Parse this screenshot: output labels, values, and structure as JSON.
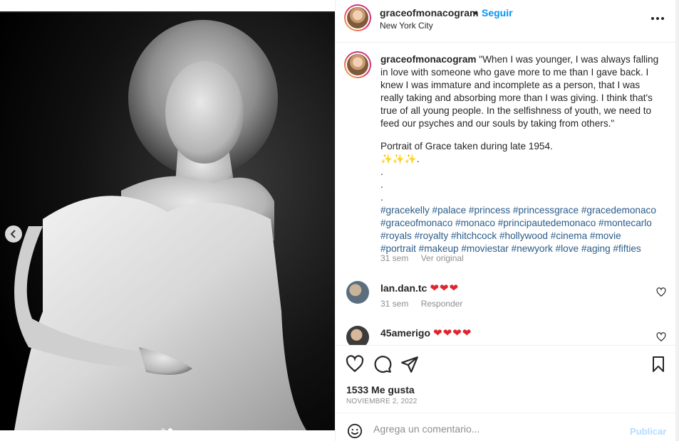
{
  "post": {
    "username": "graceofmonacogram",
    "separator": "•",
    "follow_label": "Seguir",
    "location": "New York City",
    "more_icon": "more-horizontal-icon"
  },
  "caption": {
    "username": "graceofmonacogram",
    "quote_lines": [
      "\"When I was younger, I was always falling",
      "in love with someone who gave more to me than I gave back. I",
      "knew I was immature and incomplete as a person, that I was",
      "really taking and absorbing more than I was giving. I think that's",
      "true of all young people. In the selfishness of youth, we need to",
      "feed our psyches and our souls by taking from others.\""
    ],
    "portrait_note": "Portrait of Grace taken during late 1954.",
    "emojis": "✨✨✨.",
    "dots": [
      ".",
      ".",
      "."
    ],
    "hashtag_lines": [
      "#gracekelly #palace #princess #princessgrace #gracedemonaco",
      "#graceofmonaco #monaco #principautedemonaco #montecarlo",
      "#royals #royalty #hitchcock #hollywood #cinema #movie",
      "#portrait #makeup #moviestar #newyork #love #aging #fifties"
    ],
    "time": "31 sem",
    "see_original": "Ver original"
  },
  "comments": [
    {
      "username": "lan.dan.tc",
      "text": "❤❤❤",
      "time": "31 sem",
      "reply": "Responder"
    },
    {
      "username": "45amerigo",
      "text": "❤❤❤❤"
    }
  ],
  "stats": {
    "likes": "1533 Me gusta",
    "date": "NOVIEMBRE 2, 2022"
  },
  "composer": {
    "placeholder": "Agrega un comentario...",
    "publish_label": "Publicar"
  },
  "colors": {
    "accent": "#0095f6",
    "heart": "#e0242e",
    "hashtag": "#2b5c8a",
    "muted": "#8e8e8e",
    "publish_disabled": "#b3dbff"
  },
  "carousel": {
    "slide_count": 2,
    "active_slide": 2
  }
}
